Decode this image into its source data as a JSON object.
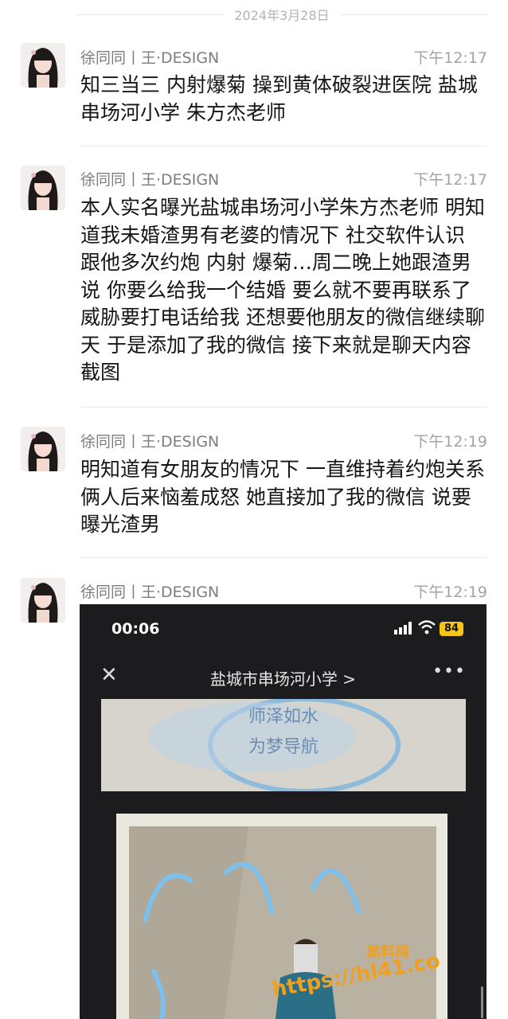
{
  "date_separator": "2024年3月28日",
  "messages": [
    {
      "sender": "徐同同丨王·DESIGN",
      "time": "下午12:17",
      "text": "知三当三 内射爆菊 操到黄体破裂进医院 盐城串场河小学 朱方杰老师"
    },
    {
      "sender": "徐同同丨王·DESIGN",
      "time": "下午12:17",
      "text": "本人实名曝光盐城串场河小学朱方杰老师 明知道我未婚渣男有老婆的情况下 社交软件认识 跟他多次约炮 内射 爆菊…周二晚上她跟渣男说 你要么给我一个结婚 要么就不要再联系了 威胁要打电话给我 还想要他朋友的微信继续聊天 于是添加了我的微信 接下来就是聊天内容截图"
    },
    {
      "sender": "徐同同丨王·DESIGN",
      "time": "下午12:19",
      "text": "明知道有女朋友的情况下 一直维持着约炮关系 俩人后来恼羞成怒 她直接加了我的微信 说要曝光渣男"
    },
    {
      "sender": "徐同同丨王·DESIGN",
      "time": "下午12:19",
      "text": ""
    }
  ],
  "screenshot": {
    "clock": "00:06",
    "battery": "84",
    "title": "盐城市串场河小学 >",
    "banner_line1": "师泽如水",
    "banner_line2": "为梦导航",
    "watermark_top": "黑料网",
    "watermark": "https://hl41.co"
  },
  "icons": [
    "avatar",
    "close-icon",
    "more-icon",
    "signal-icon",
    "wifi-icon",
    "battery-icon"
  ],
  "colors": {
    "text": "#151515",
    "meta": "#a3a3a3",
    "divider": "#e9e9e9",
    "watermark": "#f0a020"
  }
}
